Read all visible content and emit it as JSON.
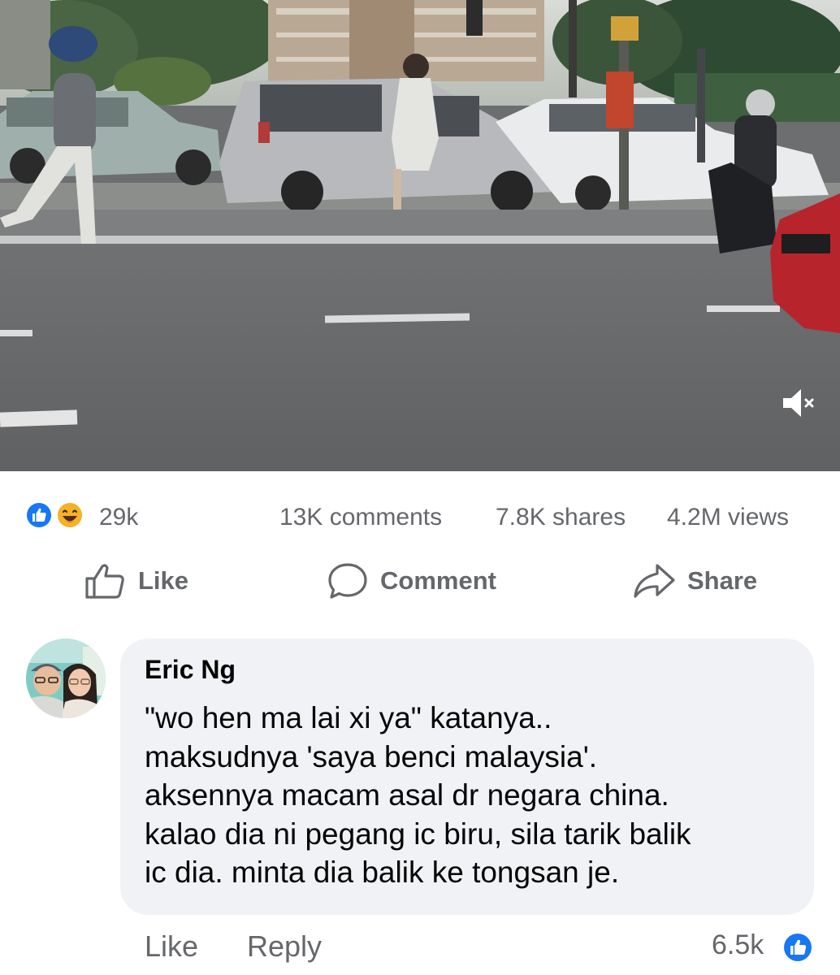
{
  "video": {
    "muted_icon": "speaker-muted-icon"
  },
  "stats": {
    "reaction_icons": [
      "like-reaction-icon",
      "haha-reaction-icon"
    ],
    "reaction_count": "29k",
    "comments": "13K comments",
    "shares": "7.8K shares",
    "views": "4.2M views"
  },
  "actions": {
    "like_label": "Like",
    "comment_label": "Comment",
    "share_label": "Share"
  },
  "comment": {
    "author": "Eric Ng",
    "lines": [
      "\"wo hen ma lai xi ya\" katanya..",
      "maksudnya 'saya benci malaysia'.",
      "aksennya macam asal dr negara china.",
      "kalao dia ni pegang ic biru, sila tarik balik",
      "ic dia. minta dia balik ke tongsan je."
    ],
    "like_label": "Like",
    "reply_label": "Reply",
    "reaction_count": "6.5k"
  },
  "colors": {
    "facebook_blue": "#1877f2",
    "haha_yellow": "#f7b125",
    "secondary_text": "#65676b",
    "bubble_bg": "#f0f2f5"
  }
}
